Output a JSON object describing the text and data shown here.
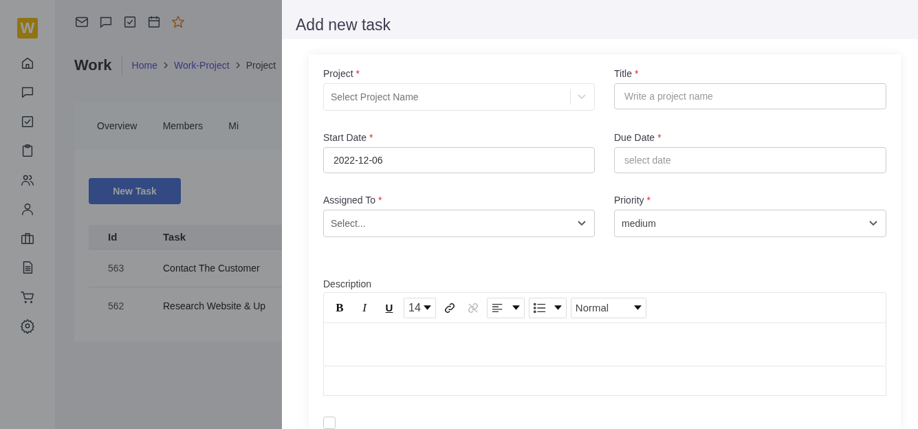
{
  "app": {
    "logo": "W",
    "page_title": "Work",
    "breadcrumb": [
      {
        "label": "Home",
        "link": true
      },
      {
        "label": "Work-Project",
        "link": true
      },
      {
        "label": "Project",
        "link": false
      }
    ],
    "tabs": [
      {
        "label": "Overview"
      },
      {
        "label": "Members"
      },
      {
        "label": "Mi"
      }
    ],
    "new_task_button": "New Task",
    "table": {
      "columns": [
        "Id",
        "Task"
      ],
      "rows": [
        [
          "563",
          "Contact The Customer"
        ],
        [
          "562",
          "Research Website & Up"
        ]
      ]
    }
  },
  "drawer": {
    "title": "Add new task",
    "fields": [
      {
        "label": "Project",
        "required_mark": "*",
        "kind": "select",
        "disabled": true,
        "placeholder": "Select Project Name"
      },
      {
        "label": "Title",
        "required_mark": "*",
        "kind": "input",
        "placeholder": "Write a project name"
      },
      {
        "label": "Start Date",
        "required_mark": "*",
        "kind": "input",
        "value": "2022-12-06"
      },
      {
        "label": "Due Date",
        "required_mark": "*",
        "kind": "input",
        "placeholder": "select date"
      },
      {
        "label": "Assigned To",
        "required_mark": "*",
        "kind": "select",
        "disabled": false,
        "placeholder": "Select..."
      },
      {
        "label": "Priority",
        "required_mark": "*",
        "kind": "select",
        "disabled": false,
        "value": "medium"
      }
    ],
    "description": {
      "label": "Description",
      "toolbar": {
        "bold": "B",
        "italic": "I",
        "underline": "U",
        "font_size": "14",
        "heading": "Normal"
      }
    },
    "checkbox": {
      "checked": false
    }
  }
}
